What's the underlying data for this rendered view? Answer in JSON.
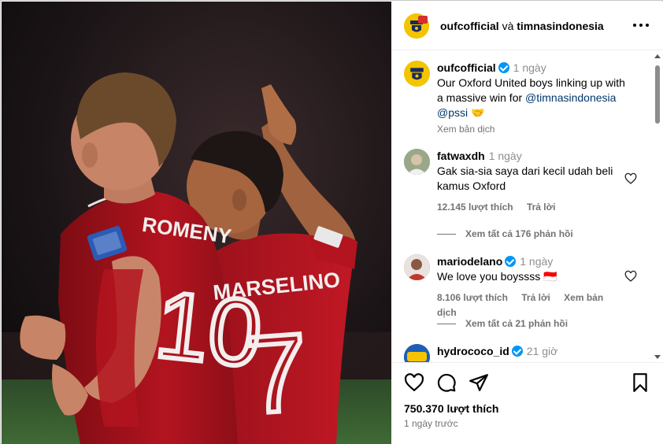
{
  "post": {
    "author": "oufcofficial",
    "joiner": "và",
    "collaborator": "timnasindonesia",
    "photo": {
      "left_name": "ROMENY",
      "left_number": "10",
      "right_name": "MARSELINO",
      "right_number": "7"
    },
    "avatar_text": "OXFORD UNITED"
  },
  "caption": {
    "username": "oufcofficial",
    "time": "1 ngày",
    "text_before": "Our Oxford United boys linking up with a massive win for ",
    "mention1": "@timnasindonesia",
    "mention2": "@pssi",
    "emoji": "🤝",
    "translate": "Xem bản dịch"
  },
  "comments": [
    {
      "username": "fatwaxdh",
      "time": "1 ngày",
      "text": "Gak sia-sia saya dari kecil udah beli kamus Oxford",
      "likes": "12.145 lượt thích",
      "reply": "Trả lời",
      "view_replies": "Xem tất cả 176 phản hồi"
    },
    {
      "username": "mariodelano",
      "time": "1 ngày",
      "text": "We love you boyssss 🇮🇩",
      "likes": "8.106 lượt thích",
      "reply": "Trả lời",
      "translate": "Xem bản dịch",
      "view_replies": "Xem tất cả 21 phản hồi"
    },
    {
      "username": "hydrococo_id",
      "time": "21 giờ",
      "avatar_text": "Hydro Coco"
    }
  ],
  "footer": {
    "likes": "750.370 lượt thích",
    "ago": "1 ngày trước"
  },
  "colors": {
    "jersey_red": "#b3141f",
    "verified_blue": "#0095f6",
    "link_blue": "#00376b",
    "oxford_yellow": "#f2c500"
  }
}
